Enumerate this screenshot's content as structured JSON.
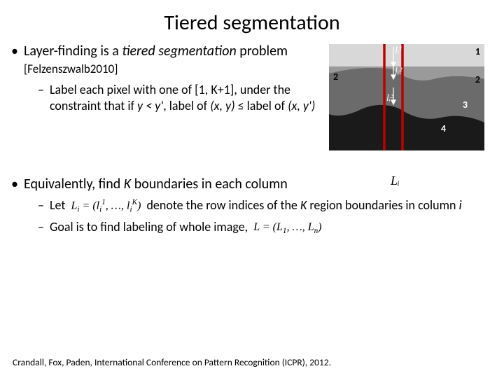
{
  "title": "Tiered segmentation",
  "b1": {
    "pre": "Layer-finding is a ",
    "em": "tiered segmentation",
    "post": " problem ",
    "ref": "[Felzenszwalb2010]"
  },
  "b1s": {
    "pre": "Label each pixel with one of ",
    "range": "[1, K+1]",
    "mid": ", under the constraint that if ",
    "cond": "y < y'",
    "post": ", label of ",
    "xy": "(x, y)",
    "leq": " ≤ ",
    "post2": "label of ",
    "xy2": "(x, y')"
  },
  "b2": {
    "pre": "Equivalently, find ",
    "K": "K",
    "post": " boundaries in each column"
  },
  "b2s1": {
    "pre": "Let ",
    "eq": "Lᵢ = (lᵢ¹, …, lᵢᴷ)",
    "mid": " denote the row indices of the ",
    "K": "K",
    "post": " region boundaries in column ",
    "i": "i"
  },
  "b2s2": {
    "pre": "Goal is to find labeling of whole image, ",
    "eq": "L = (L₁, …, Lₙ)"
  },
  "footer": "Crandall, Fox, Paden, International Conference on Pattern Recognition (ICPR), 2012.",
  "fig": {
    "l1": "lᵢ¹",
    "l2": "lᵢ²",
    "l3": "lᵢ³",
    "n1": "1",
    "n2l": "2",
    "n2r": "2",
    "n3": "3",
    "n4": "4",
    "col": "Lᵢ"
  }
}
